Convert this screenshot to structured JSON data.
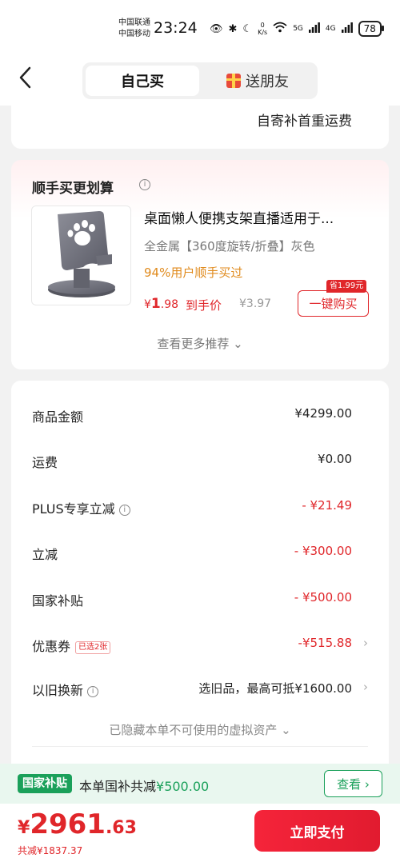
{
  "status_bar": {
    "carrier_1": "中国联通",
    "carrier_2": "中国移动",
    "time": "23:24",
    "speed_value": "0",
    "speed_unit": "K/s",
    "signal_1": "5G",
    "signal_2": "4G",
    "battery": "78"
  },
  "header": {
    "tab_self": "自己买",
    "tab_gift": "送朋友"
  },
  "shipping": {
    "note": "自寄补首重运费"
  },
  "recommend": {
    "title": "顺手买更划算",
    "product": {
      "title": "桌面懒人便携支架直播适用于...",
      "spec": "全金属【360度旋转/折叠】灰色",
      "stat": "94%用户顺手买过",
      "price_currency": "¥",
      "price_int": "1",
      "price_dec": ".98",
      "price_label": "到手价",
      "orig_price": "¥3.97",
      "save_badge": "省1.99元",
      "buy_label": "一键购买"
    },
    "more_label": "查看更多推荐 ⌄"
  },
  "summary": {
    "rows": [
      {
        "label": "商品金额",
        "value": "¥4299.00"
      },
      {
        "label": "运费",
        "value": "¥0.00"
      },
      {
        "label": "PLUS专享立减",
        "value": "- ¥21.49"
      },
      {
        "label": "立减",
        "value": "- ¥300.00"
      },
      {
        "label": "国家补贴",
        "value": "- ¥500.00"
      },
      {
        "label": "优惠券",
        "tag": "已选2张",
        "value": "-¥515.88"
      },
      {
        "label": "以旧换新",
        "value": "选旧品，最高可抵¥1600.00"
      }
    ],
    "hidden_note": "已隐藏本单不可使用的虚拟资产 ⌄"
  },
  "subsidy": {
    "tag": "国家补贴",
    "text_prefix": "本单国补共减",
    "text_amount": "¥500.00",
    "view_label": "查看 ›"
  },
  "bottom": {
    "currency": "¥",
    "total_int": "2961",
    "total_dec": ".63",
    "saved": "共减¥1837.37",
    "pay_label": "立即支付"
  },
  "colors": {
    "accent_red": "#e0262a",
    "subsidy_green": "#1aa05a"
  }
}
